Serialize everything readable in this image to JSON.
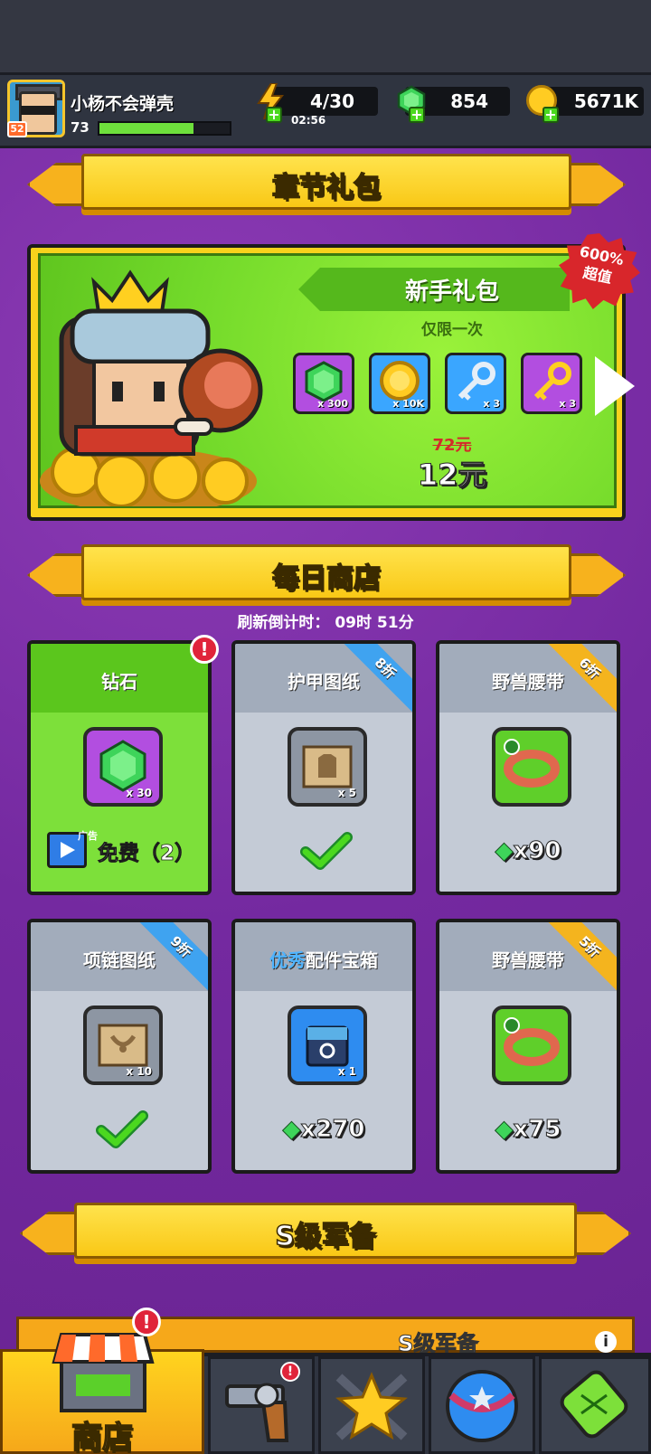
{
  "player": {
    "name": "小杨不会弹壳",
    "level": "73",
    "badge": "52",
    "xp_fraction": 0.72
  },
  "resources": {
    "energy": "4/30",
    "energy_timer": "02:56",
    "gems": "854",
    "coins": "5671K"
  },
  "chapter_banner": {
    "title": "章节礼包"
  },
  "gift": {
    "title": "新手礼包",
    "subtitle": "仅限一次",
    "badge": "600%\n超值",
    "badge_line1": "600%",
    "badge_line2": "超值",
    "items": [
      {
        "icon": "gem-icon",
        "count": "x 300"
      },
      {
        "icon": "coin-icon",
        "count": "x 10K"
      },
      {
        "icon": "silver-key-icon",
        "count": "x 3"
      },
      {
        "icon": "gold-key-icon",
        "count": "x 3"
      }
    ],
    "old_price": "72元",
    "new_price": "12元"
  },
  "daily_banner": {
    "title": "每日商店"
  },
  "refresh": "刷新倒计时： 09时 51分",
  "cards": [
    {
      "name": "钻石",
      "qty": "x 30",
      "ad_tag": "广告",
      "price": "免费（2）"
    },
    {
      "name": "护甲图纸",
      "qty": "x 5",
      "discount": "8折"
    },
    {
      "name": "野兽腰带",
      "price": "x90",
      "discount": "6折"
    },
    {
      "name": "项链图纸",
      "qty": "x 10",
      "discount": "9折"
    },
    {
      "name_prefix": "优秀",
      "name": "配件宝箱",
      "qty": "x 1",
      "price": "x270"
    },
    {
      "name": "野兽腰带",
      "price": "x75",
      "discount": "5折"
    }
  ],
  "s_banner": {
    "title": "S级军备",
    "strip": "S级军备"
  },
  "nav": {
    "shop": "商店"
  },
  "colors": {
    "purple_bg": "#7b2fa0",
    "banner_yellow": "#f9c816",
    "gift_green": "#72d92a",
    "alert_red": "#e0243a"
  }
}
